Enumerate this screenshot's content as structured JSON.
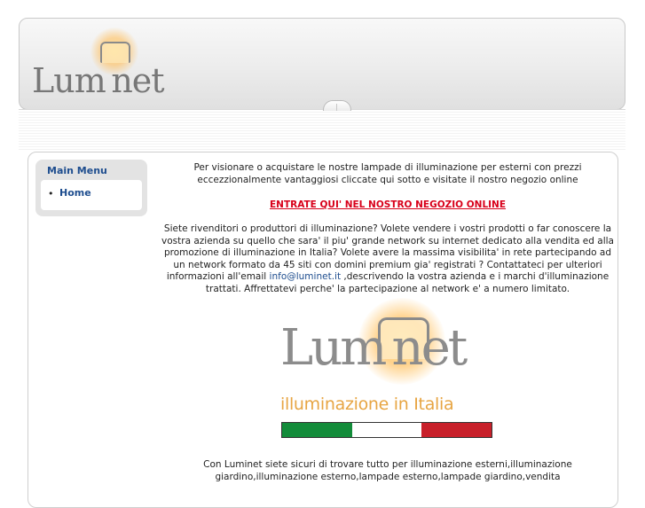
{
  "header": {
    "logo_text": "Lum net"
  },
  "sidebar": {
    "title": "Main Menu",
    "items": [
      {
        "label": "Home"
      }
    ]
  },
  "main": {
    "intro": "Per visionare o acquistare le nostre lampade di illuminazione per esterni con prezzi eccezzionalmente vantaggiosi cliccate qui sotto e visitate il nostro negozio online",
    "cta": "ENTRATE QUI' NEL NOSTRO NEGOZIO ONLINE",
    "paragraph_before_email": "Siete rivenditori o produttori di illuminazione? Volete vendere i vostri prodotti o far conoscere la vostra azienda su quello che sara' il piu' grande network su internet dedicato alla vendita ed alla promozione di illuminazione in Italia? Volete avere la massima visibilita' in rete partecipando ad un network formato da 45 siti con domini premium gia' registrati ? Contattateci per ulteriori informazioni all'email",
    "email": "info@luminet.it",
    "paragraph_after_email": ",descrivendo la vostra azienda e i marchi d'illuminazione trattati. Affrettatevi perche' la partecipazione al network e' a numero limitato.",
    "big_logo": {
      "title": "Lum net",
      "subtitle": "illuminazione in Italia"
    },
    "footer_text": "Con Luminet siete sicuri di trovare tutto per illuminazione esterni,illuminazione giardino,illuminazione esterno,lampade esterno,lampade giardino,vendita"
  },
  "colors": {
    "link_blue": "#1f4e8f",
    "cta_red": "#d8001a",
    "flag_green": "#138c3a",
    "flag_white": "#ffffff",
    "flag_red": "#c8202a"
  },
  "icons": {
    "lamp": "lamp-logo-icon",
    "knob": "header-handle-icon"
  }
}
